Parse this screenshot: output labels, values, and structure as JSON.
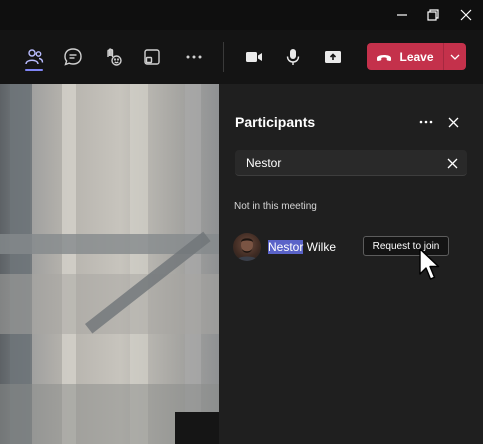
{
  "window": {
    "minimize_icon": "minimize-icon",
    "restore_icon": "restore-icon",
    "close_icon": "close-icon"
  },
  "toolbar": {
    "buttons": [
      {
        "name": "participants-icon",
        "active": true
      },
      {
        "name": "chat-icon"
      },
      {
        "name": "reactions-icon"
      },
      {
        "name": "rooms-icon"
      },
      {
        "name": "more-options-icon"
      },
      {
        "name": "camera-icon"
      },
      {
        "name": "microphone-icon"
      },
      {
        "name": "share-icon"
      }
    ],
    "leave_label": "Leave"
  },
  "participants_panel": {
    "title": "Participants",
    "search": {
      "value": "Nestor"
    },
    "section_label": "Not in this meeting",
    "people": [
      {
        "highlight": "Nestor",
        "rest": " Wilke",
        "action_label": "Request to join"
      }
    ]
  },
  "colors": {
    "accent": "#7f85f5",
    "leave": "#c4314b",
    "highlight": "#5a63c8",
    "panel_bg": "#1f1f1f"
  }
}
